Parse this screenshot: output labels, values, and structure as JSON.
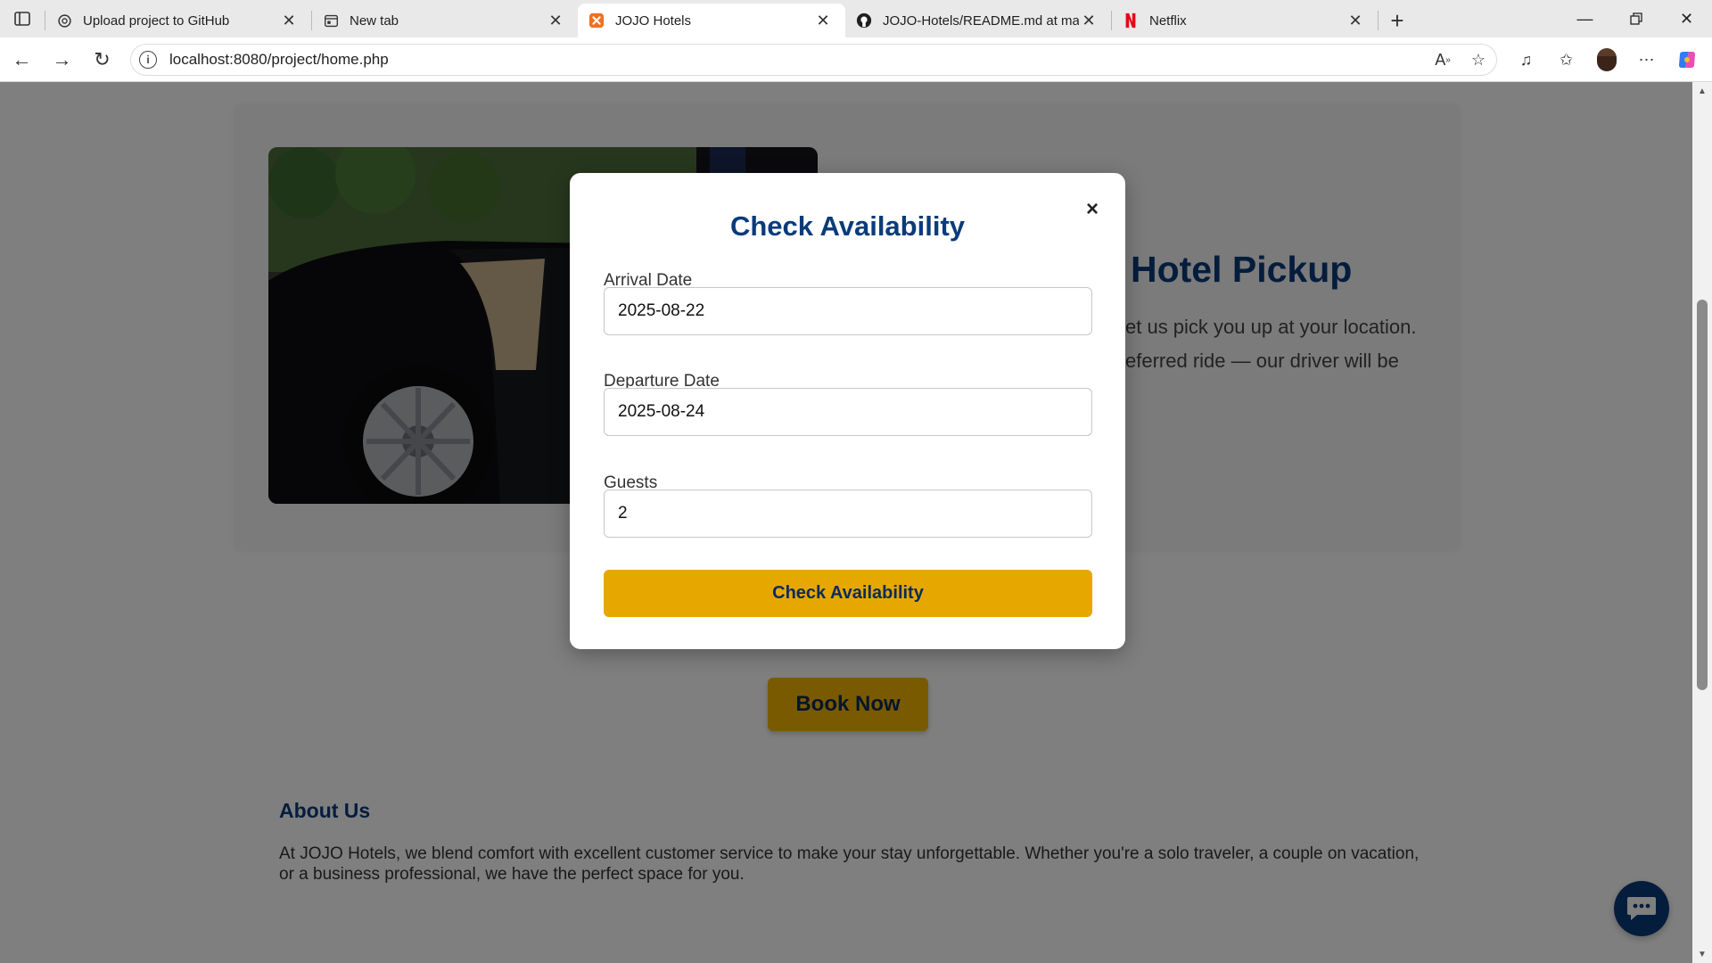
{
  "browser": {
    "tabs": [
      {
        "title": "Upload project to GitHub",
        "icon": "openai-icon"
      },
      {
        "title": "New tab",
        "icon": "newtab-icon"
      },
      {
        "title": "JOJO Hotels",
        "icon": "xampp-icon",
        "active": true
      },
      {
        "title": "JOJO-Hotels/README.md at main",
        "icon": "github-icon"
      },
      {
        "title": "Netflix",
        "icon": "netflix-icon"
      }
    ],
    "url": "localhost:8080/project/home.php"
  },
  "page": {
    "pickup": {
      "title": "Hotel Pickup",
      "text_line1": "et us pick you up at your location.",
      "text_line2": "eferred ride — our driver will be"
    },
    "book_now_label": "Book Now",
    "about": {
      "title": "About Us",
      "text": "At JOJO Hotels, we blend comfort with excellent customer service to make your stay unforgettable. Whether you're a solo traveler, a couple on vacation, or a business professional, we have the perfect space for you."
    }
  },
  "modal": {
    "title": "Check Availability",
    "close_label": "×",
    "arrival": {
      "label": "Arrival Date",
      "value": "2025-08-22"
    },
    "departure": {
      "label": "Departure Date",
      "value": "2025-08-24"
    },
    "guests": {
      "label": "Guests",
      "value": "2"
    },
    "submit_label": "Check Availability"
  },
  "colors": {
    "brand_navy": "#0b3b7a",
    "accent_gold": "#e6a800"
  }
}
